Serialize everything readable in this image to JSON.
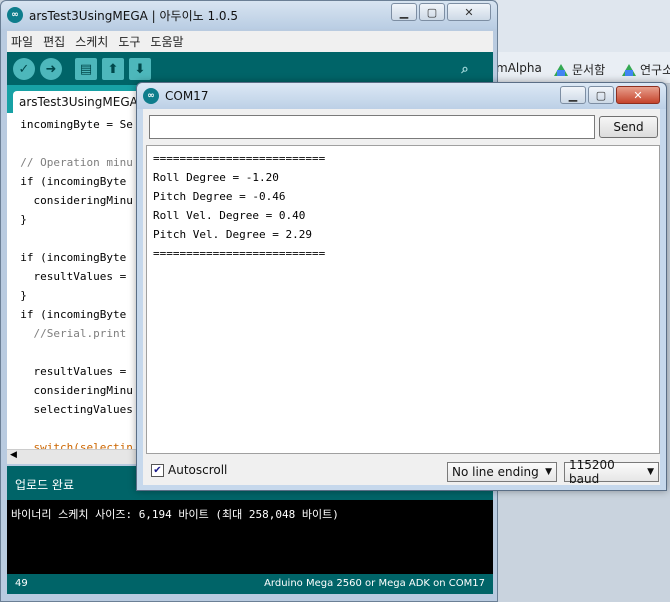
{
  "browser": {
    "bookmarks": [
      {
        "label": "mAlpha",
        "icon": "none"
      },
      {
        "label": "문서함",
        "icon": "drive-icon"
      },
      {
        "label": "연구소",
        "icon": "drive-icon"
      }
    ]
  },
  "ide": {
    "title": "arsTest3UsingMEGA | 아두이노 1.0.5",
    "menu": [
      "파일",
      "편집",
      "스케치",
      "도구",
      "도움말"
    ],
    "toolbar": {
      "verify_icon": "check-icon",
      "upload_icon": "arrow-right-icon",
      "new_icon": "new-file-icon",
      "open_icon": "open-arrow-up-icon",
      "save_icon": "save-arrow-down-icon",
      "serial_icon": "magnifier-icon"
    },
    "tab_label": "arsTest3UsingMEGA",
    "code_lines": [
      "  incomingByte = Se",
      "",
      "  // Operation minu",
      "  if (incomingByte",
      "    consideringMinu",
      "  }",
      "",
      "  if (incomingByte",
      "    resultValues =",
      "  }",
      "  if (incomingByte",
      "    //Serial.print",
      "",
      "    resultValues =",
      "    consideringMinu",
      "    selectingValues",
      "",
      "    switch(selectin"
    ],
    "status": "업로드 완료",
    "console_text": "바이너리 스케치 사이즈: 6,194 바이트 (최대 258,048 바이트)",
    "footer_line": "49",
    "footer_board": "Arduino Mega 2560 or Mega ADK on COM17"
  },
  "serial": {
    "title": "COM17",
    "input_value": "",
    "send_label": "Send",
    "output_lines": [
      "==========================",
      "Roll Degree = -1.20",
      "Pitch Degree = -0.46",
      "Roll Vel. Degree = 0.40",
      "Pitch Vel. Degree = 2.29",
      "=========================="
    ],
    "autoscroll_label": "Autoscroll",
    "autoscroll_checked": true,
    "line_ending": "No line ending",
    "baud": "115200 baud"
  }
}
